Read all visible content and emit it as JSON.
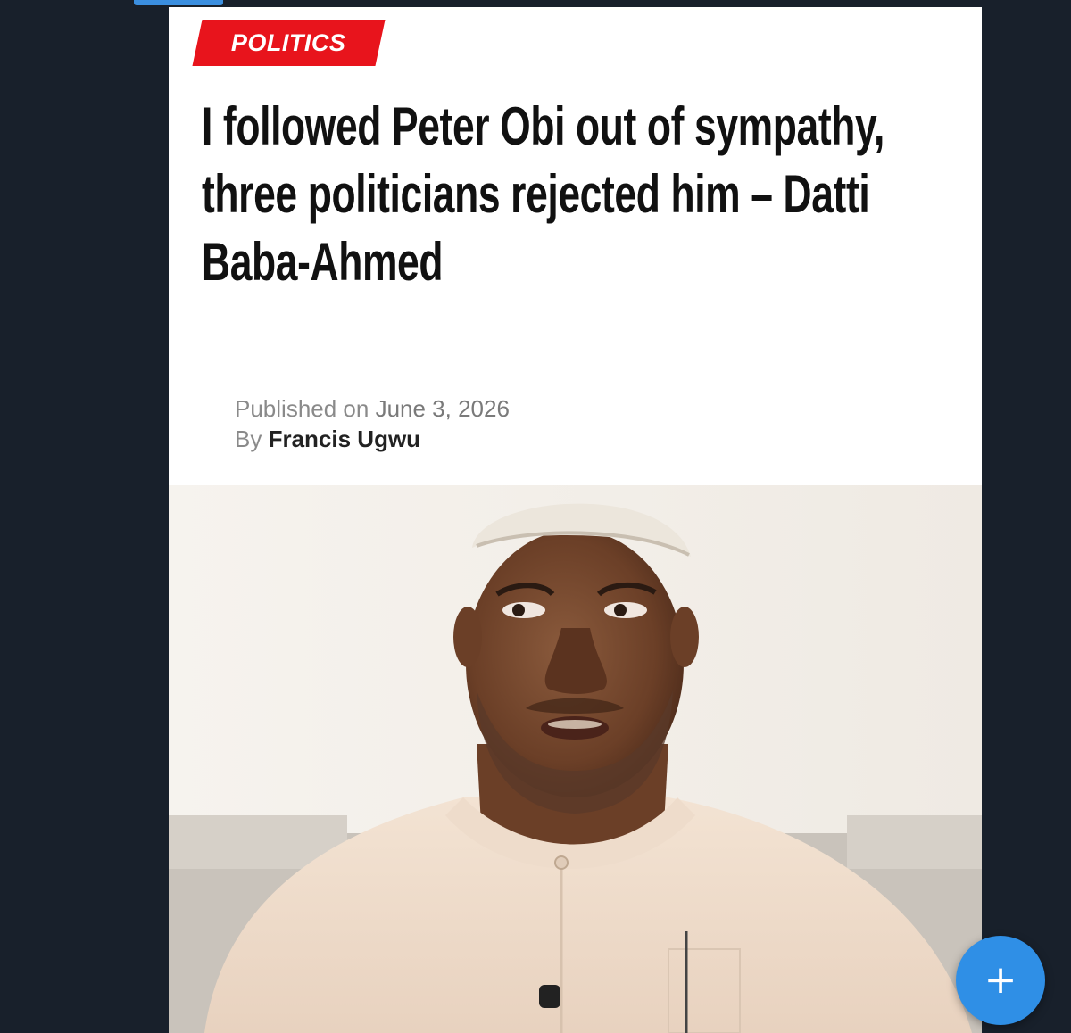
{
  "article": {
    "category": "POLITICS",
    "headline": "I followed Peter Obi out of sympathy, three politicians rejected him – Datti Baba-Ahmed",
    "published_label": "Published on",
    "published_date": "June 3, 2026",
    "by_label": "By",
    "author": "Francis Ugwu"
  },
  "fab": {
    "icon": "plus-icon",
    "symbol": "+"
  },
  "colors": {
    "badge": "#e8141c",
    "fab": "#2f8fe6",
    "background": "#18202b"
  }
}
